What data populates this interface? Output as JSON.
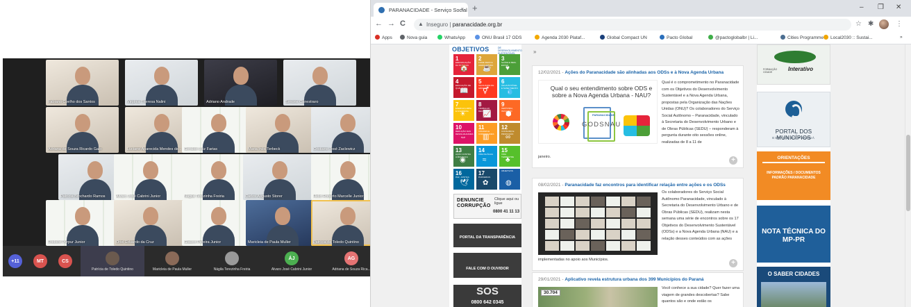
{
  "meeting": {
    "tiles": [
      {
        "name": "Fabiano Coelho dos Santos"
      },
      {
        "name": "Virgínia Theresa Nalini"
      },
      {
        "name": "Adriano Andrade"
      },
      {
        "name": "Simone Canestraro"
      },
      {
        "name": "Adriana de Souza Ricardo Galo"
      },
      {
        "name": "Luciane Aparecida Mendes de..."
      },
      {
        "name": "Geraldo Luiz Farias"
      },
      {
        "name": "Maria Inês Terbeck"
      },
      {
        "name": "Cristiano José Zaclewicz"
      },
      {
        "name": "Patrícia Brochardo Ramos"
      },
      {
        "name": "Álvaro José Cabrini Junior"
      },
      {
        "name": "Nágila Terezinha Freiria"
      },
      {
        "name": "Carlos Augusto Storer"
      },
      {
        "name": "Helio Roberto Marcelle Junior"
      },
      {
        "name": "Rodolfo Purpur Junior"
      },
      {
        "name": "Oriel Eduardo da Cruz"
      },
      {
        "name": "Glauco Pereira Junior"
      },
      {
        "name": "Maricleia de Paula Muller"
      },
      {
        "name": "Patrícia de Toledo Quintino"
      }
    ],
    "bar_chips": [
      "+11",
      "MT",
      "CS"
    ],
    "bar_participants": [
      {
        "initials": "",
        "name": "Patrícia de Toledo Quintino"
      },
      {
        "initials": "",
        "name": "Maricleia de Paula Muller"
      },
      {
        "initials": "",
        "name": "Nágila Terezinha Freiria"
      },
      {
        "initials": "ÁJ",
        "name": "Álvaro José Cabrini Junior"
      },
      {
        "initials": "AG",
        "name": "Adriana de Souza Rica..."
      }
    ]
  },
  "browser": {
    "tab_title": "PARANACIDADE - Serviço Social",
    "tab_close": "×",
    "new_tab": "+",
    "window_controls": [
      "–",
      "❐",
      "✕"
    ],
    "nav": {
      "back": "←",
      "forward": "→",
      "reload": "C"
    },
    "address": {
      "insecure_label": "Inseguro",
      "separator": "|",
      "url": "paranacidade.org.br"
    },
    "bookmarks": [
      {
        "label": "Apps",
        "color": "#d93025"
      },
      {
        "label": "Nova guia",
        "color": "#5f6368"
      },
      {
        "label": "WhatsApp",
        "color": "#25d366"
      },
      {
        "label": "ONU Brasil 17 ODS",
        "color": "#5b92e5"
      },
      {
        "label": "Agenda 2030 Plataf...",
        "color": "#f2a900"
      },
      {
        "label": "Global Compact UN",
        "color": "#1a3f7a"
      },
      {
        "label": "Pacto Global",
        "color": "#2a6fbb"
      },
      {
        "label": "@pactoglobalbr | Li...",
        "color": "#3fae49"
      },
      {
        "label": "Cities Programme",
        "color": "#4c6e91"
      },
      {
        "label": "Local2030 :: Sustai...",
        "color": "#f0a500"
      }
    ],
    "bookmarks_more": "»"
  },
  "site": {
    "ods_title": "OBJETIVOS",
    "ods_subtitle": "DE DESENVOLVIMENTO SUSTENTÁVEL",
    "sdgs": [
      {
        "n": "1",
        "label": "ERRADICAÇÃO DA POBREZA",
        "color": "#e5243b",
        "icon": "🏠"
      },
      {
        "n": "2",
        "label": "FOME ZERO E AGRICULTURA",
        "color": "#dda63a",
        "icon": "☕"
      },
      {
        "n": "3",
        "label": "SAÚDE E BEM-ESTAR",
        "color": "#4c9f38",
        "icon": "♥"
      },
      {
        "n": "4",
        "label": "EDUCAÇÃO DE QUALIDADE",
        "color": "#c5192d",
        "icon": "📖"
      },
      {
        "n": "5",
        "label": "IGUALDADE DE GÊNERO",
        "color": "#ff3a21",
        "icon": "⚥"
      },
      {
        "n": "6",
        "label": "ÁGUA POTÁVEL E SANEAMENTO",
        "color": "#26bde2",
        "icon": "💧"
      },
      {
        "n": "7",
        "label": "ENERGIA LIMPA E ACESSÍVEL",
        "color": "#fcc30b",
        "icon": "☀"
      },
      {
        "n": "8",
        "label": "TRABALHO DECENTE",
        "color": "#a21942",
        "icon": "📈"
      },
      {
        "n": "9",
        "label": "INDÚSTRIA, INOVAÇÃO",
        "color": "#fd6925",
        "icon": "⬢"
      },
      {
        "n": "10",
        "label": "REDUÇÃO DAS DESIGUALDADES",
        "color": "#dd1367",
        "icon": "⇔"
      },
      {
        "n": "11",
        "label": "CIDADES E COMUNIDADES",
        "color": "#fd9d24",
        "icon": "▥"
      },
      {
        "n": "12",
        "label": "CONSUMO E PRODUÇÃO",
        "color": "#bf8b2e",
        "icon": "∞"
      },
      {
        "n": "13",
        "label": "AÇÃO CONTRA A MUDANÇA",
        "color": "#3f7e44",
        "icon": "◉"
      },
      {
        "n": "14",
        "label": "VIDA NA ÁGUA",
        "color": "#0a97d9",
        "icon": "≈"
      },
      {
        "n": "15",
        "label": "VIDA TERRESTRE",
        "color": "#56c02b",
        "icon": "♣"
      },
      {
        "n": "16",
        "label": "PAZ, JUSTIÇA",
        "color": "#00689d",
        "icon": "🕊"
      },
      {
        "n": "17",
        "label": "PARCERIAS",
        "color": "#19486a",
        "icon": "✿"
      },
      {
        "n": "",
        "label": "OBJETIVOS",
        "color": "#1a5fa6",
        "icon": "◍"
      }
    ],
    "denuncie": {
      "title": "DENUNCIE CORRUPÇÃO",
      "call": "Clique aqui ou ligue",
      "phone": "0800 41 11 13"
    },
    "portal_transparencia": "PORTAL DA TRANSPARÊNCIA",
    "fale_ouvidor": "FALE COM O OUVIDOR",
    "sos": {
      "logo": "SOS",
      "phone": "0800 642 0345"
    },
    "breadcrumb_arrow": "»",
    "posts": [
      {
        "date": "12/02/2021 -",
        "title": "Ações do Paranacidade são alinhadas aos ODSs e à Nova Agenda Urbana",
        "image_question": "Qual o seu entendimento sobre ODS e sobre a Nova Agenda Urbana - NAU?",
        "image_word": "GODSNAU",
        "image_brand": "PARANACIDADE",
        "text": "Qual é o comprometimento no Paranacidade com os Objetivos do Desenvolvimento Sustentável e a Nova Agenda Urbana, propostas pela Organização das Nações Unidas (ONU)? Os colaboradores do Serviço Social Autônomo – Paranacidade, vinculado à Secretaria do Desenvolvimento Urbano e de Obras Públicas (SEDU) – responderam à pergunta durante oito sessões online, realizadas de 8 a 11 de",
        "after": "janeiro.",
        "more": "+"
      },
      {
        "date": "08/02/2021 -",
        "title": "Paranacidade faz encontros para identificar relação entre ações e os ODSs",
        "text": "Os colaboradores do Serviço Social Autônomo Paranacidade, vinculado à Secretaria do Desenvolvimento Urbano e de Obras Públicas (SEDU), realizam nesta semana uma série de encontros sobre os 17 Objetivos do Desenvolvimento Sustentável (ODSs) e a Nova Agenda Urbana (NAU) e a relação desses conteúdos com as ações",
        "after": "implementadas no apoio aos Municípios.",
        "more": "+"
      },
      {
        "date": "29/01/2021 -",
        "title": "Aplicativo revela estrutura urbana dos 399 Municípios do Paraná",
        "image_number": "30.704",
        "text": "Você conhece a sua cidade? Quer fazer uma viagem de grandes descobertas? Sabe quantos são e onde estão os"
      }
    ],
    "sidebar": {
      "interativo": {
        "label": "Interativo",
        "sub": "FORMAÇÃO CIDADE"
      },
      "portal": {
        "title": "PORTAL DOS MUNICÍPIOS",
        "sub": "ESTADO DO PARANÁ"
      },
      "orientacoes": {
        "title": "ORIENTAÇÕES",
        "body": "INFORMAÇÕES / DOCUMENTOS PADRÃO PARANACIDADE"
      },
      "nota": {
        "title": "NOTA TÉCNICA DO MP-PR"
      },
      "saber": {
        "title": "O SABER CIDADES"
      }
    }
  }
}
